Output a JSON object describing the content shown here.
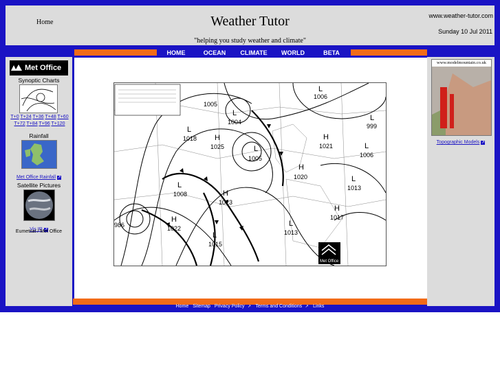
{
  "header": {
    "home": "Home",
    "title": "Weather Tutor",
    "tagline": "\"helping you study weather and climate\"",
    "url": "www.weather-tutor.com",
    "date": "Sunday 10 Jul 2011"
  },
  "nav": [
    "HOME",
    "OCEAN",
    "CLIMATE",
    "WORLD",
    "BETA"
  ],
  "left": {
    "logo": "Met Office",
    "synoptic_title": "Synoptic Charts",
    "synoptic_links_row1": [
      "T+0",
      "T+24",
      "T+36",
      "T+48",
      "T+60"
    ],
    "synoptic_links_row2": [
      "T+72",
      "T+84",
      "T+96",
      "T+120"
    ],
    "rainfall_title": "Rainfall",
    "rainfall_link": "Met Office Rainfall",
    "satellite_title": "Satellite Pictures",
    "satellite_link": "Vis IR",
    "satellite_credit": "Eumetsat / Met Office"
  },
  "right": {
    "banner": "www.modelmountain.co.uk",
    "link": "Topographic Models"
  },
  "chart": {
    "logo": "Met Office",
    "pressure_labels": [
      {
        "t": "L",
        "v": "1006"
      },
      {
        "t": "L",
        "v": "1005"
      },
      {
        "t": "L",
        "v": "1004"
      },
      {
        "t": "L",
        "v": "999"
      },
      {
        "t": "L",
        "v": "1018"
      },
      {
        "t": "H",
        "v": "1025"
      },
      {
        "t": "L",
        "v": "1005"
      },
      {
        "t": "H",
        "v": "1021"
      },
      {
        "t": "L",
        "v": "1006"
      },
      {
        "t": "H",
        "v": "1020"
      },
      {
        "t": "L",
        "v": "1008"
      },
      {
        "t": "H",
        "v": "1023"
      },
      {
        "t": "L",
        "v": "1013"
      },
      {
        "t": "H",
        "v": "1017"
      },
      {
        "t": "",
        "v": "986"
      },
      {
        "t": "H",
        "v": "1022"
      },
      {
        "t": "L",
        "v": "1013"
      },
      {
        "t": "L",
        "v": "1015"
      }
    ]
  },
  "footer": [
    "Home",
    "Sitemap",
    "Privacy Policy",
    "Terms and Conditions",
    "Links"
  ]
}
